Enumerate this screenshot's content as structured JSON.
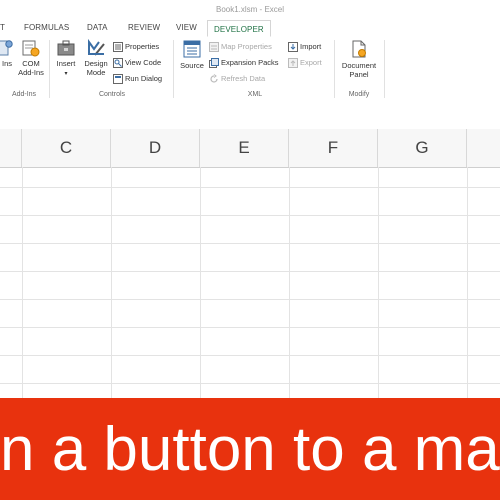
{
  "window": {
    "title": "Book1.xlsm - Excel"
  },
  "tabs": [
    {
      "label": "T"
    },
    {
      "label": "FORMULAS"
    },
    {
      "label": "DATA"
    },
    {
      "label": "REVIEW"
    },
    {
      "label": "VIEW"
    },
    {
      "label": "DEVELOPER"
    }
  ],
  "ribbon": {
    "addins": {
      "addins_label": "Ins",
      "com_label": "COM\nAdd-Ins",
      "group": "Add-Ins"
    },
    "controls": {
      "insert": "Insert",
      "design_mode": "Design\nMode",
      "properties": "Properties",
      "view_code": "View Code",
      "run_dialog": "Run Dialog",
      "group": "Controls"
    },
    "xml": {
      "source": "Source",
      "map_properties": "Map Properties",
      "expansion_packs": "Expansion Packs",
      "refresh_data": "Refresh Data",
      "import": "Import",
      "export": "Export",
      "group": "XML"
    },
    "modify": {
      "document_panel": "Document\nPanel",
      "group": "Modify"
    }
  },
  "grid": {
    "columns": [
      "C",
      "D",
      "E",
      "F",
      "G"
    ]
  },
  "banner": {
    "text": "n a button to a ma"
  },
  "colors": {
    "accent": "#217346",
    "banner": "#e8320e"
  },
  "icons": [
    "com-addins-icon",
    "insert-icon",
    "design-mode-icon",
    "properties-icon",
    "view-code-icon",
    "run-dialog-icon",
    "source-icon",
    "map-properties-icon",
    "expansion-packs-icon",
    "refresh-data-icon",
    "import-icon",
    "export-icon",
    "document-panel-icon"
  ]
}
